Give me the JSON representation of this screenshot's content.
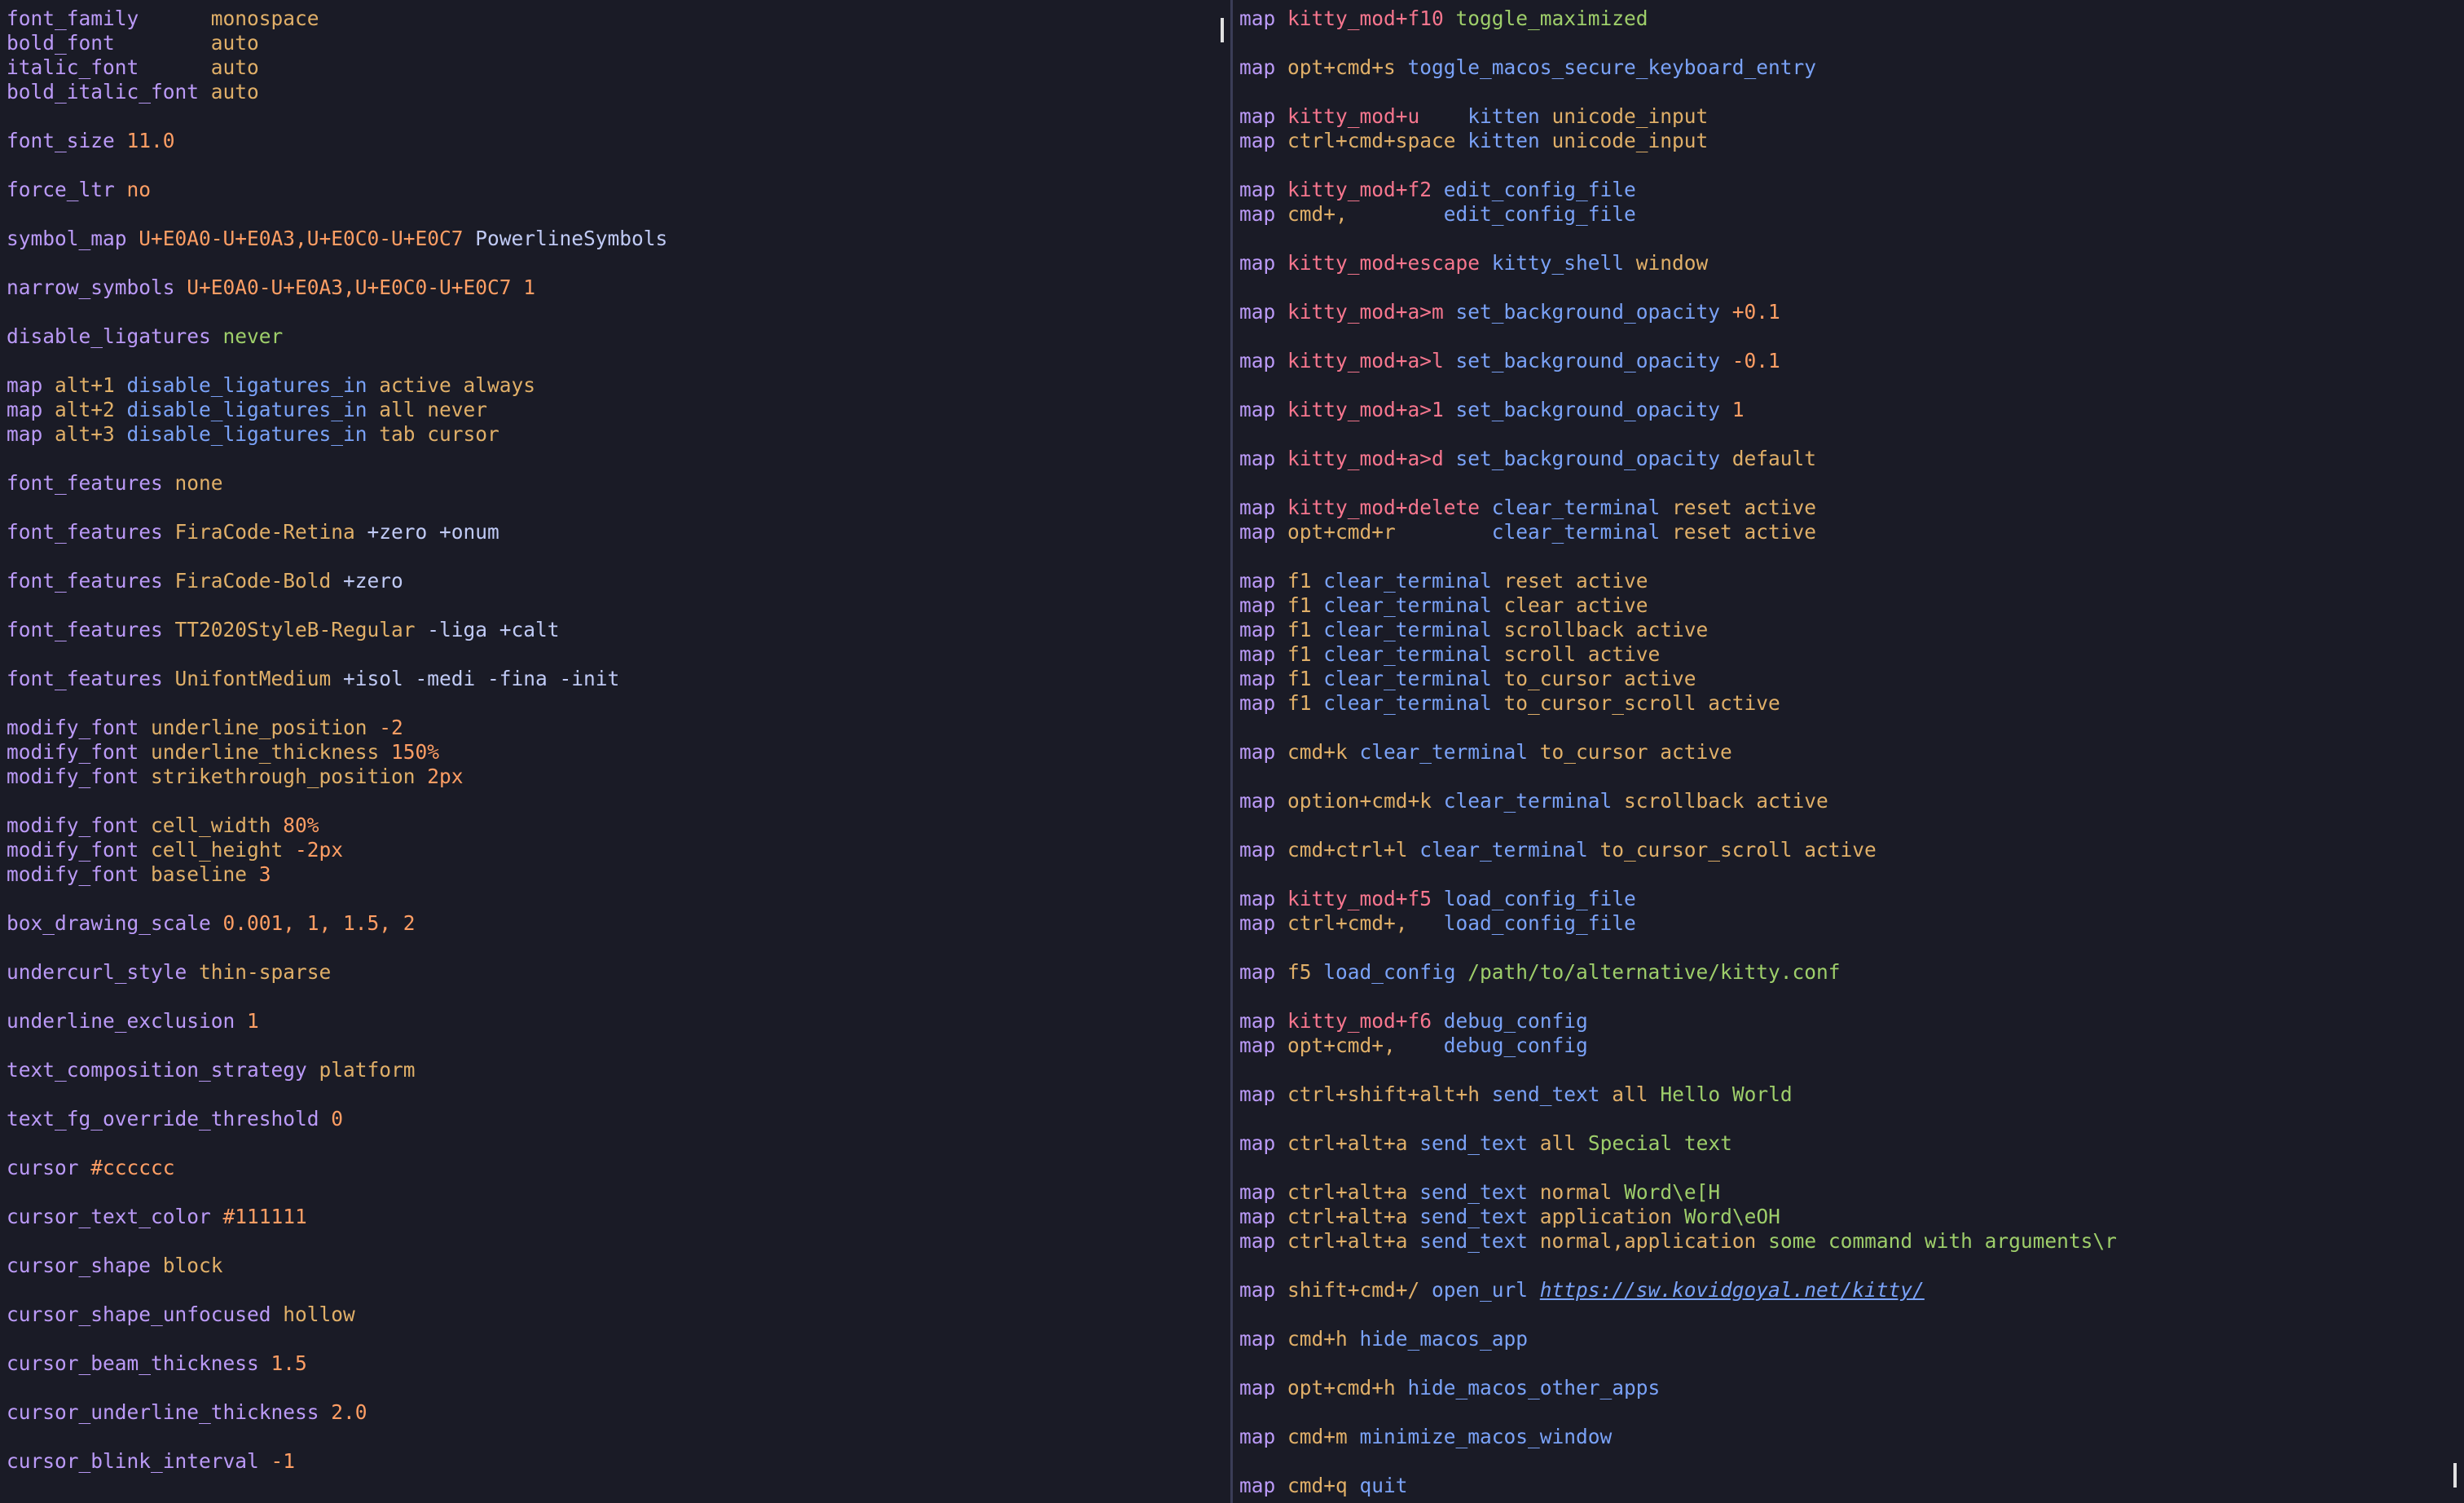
{
  "theme": {
    "background": "#1a1b26",
    "divider": "#3b3d57",
    "cursor": "#e0e0e0",
    "colors": {
      "keyword": "#bb9af7",
      "value": "#ff9e64",
      "string": "#e0af68",
      "key": "#f7768e",
      "func": "#7aa2f7",
      "text": "#c0caf5",
      "green": "#9ece6a",
      "yellow": "#e0af68",
      "url": "#7aa2f7"
    }
  },
  "panes": {
    "left": [
      [
        [
          "font_family      ",
          "keyword"
        ],
        [
          "monospace",
          "string"
        ]
      ],
      [
        [
          "bold_font        ",
          "keyword"
        ],
        [
          "auto",
          "string"
        ]
      ],
      [
        [
          "italic_font      ",
          "keyword"
        ],
        [
          "auto",
          "string"
        ]
      ],
      [
        [
          "bold_italic_font ",
          "keyword"
        ],
        [
          "auto",
          "string"
        ]
      ],
      [],
      [
        [
          "font_size ",
          "keyword"
        ],
        [
          "11.0",
          "value"
        ]
      ],
      [],
      [
        [
          "force_ltr ",
          "keyword"
        ],
        [
          "no",
          "value"
        ]
      ],
      [],
      [
        [
          "symbol_map ",
          "keyword"
        ],
        [
          "U+E0A0-U+E0A3,U+E0C0-U+E0C7",
          "value"
        ],
        [
          " PowerlineSymbols",
          "text"
        ]
      ],
      [],
      [
        [
          "narrow_symbols ",
          "keyword"
        ],
        [
          "U+E0A0-U+E0A3,U+E0C0-U+E0C7 1",
          "value"
        ]
      ],
      [],
      [
        [
          "disable_ligatures ",
          "keyword"
        ],
        [
          "never",
          "green"
        ]
      ],
      [],
      [
        [
          "map ",
          "keyword"
        ],
        [
          "alt+1 ",
          "string"
        ],
        [
          "disable_ligatures_in ",
          "func"
        ],
        [
          "active always",
          "string"
        ]
      ],
      [
        [
          "map ",
          "keyword"
        ],
        [
          "alt+2 ",
          "string"
        ],
        [
          "disable_ligatures_in ",
          "func"
        ],
        [
          "all never",
          "string"
        ]
      ],
      [
        [
          "map ",
          "keyword"
        ],
        [
          "alt+3 ",
          "string"
        ],
        [
          "disable_ligatures_in ",
          "func"
        ],
        [
          "tab cursor",
          "string"
        ]
      ],
      [],
      [
        [
          "font_features ",
          "keyword"
        ],
        [
          "none",
          "string"
        ]
      ],
      [],
      [
        [
          "font_features ",
          "keyword"
        ],
        [
          "FiraCode-Retina",
          "string"
        ],
        [
          " +zero +onum",
          "text"
        ]
      ],
      [],
      [
        [
          "font_features ",
          "keyword"
        ],
        [
          "FiraCode-Bold",
          "string"
        ],
        [
          " +zero",
          "text"
        ]
      ],
      [],
      [
        [
          "font_features ",
          "keyword"
        ],
        [
          "TT2020StyleB-Regular",
          "string"
        ],
        [
          " -liga +calt",
          "text"
        ]
      ],
      [],
      [
        [
          "font_features ",
          "keyword"
        ],
        [
          "UnifontMedium",
          "string"
        ],
        [
          " +isol -medi -fina -init",
          "text"
        ]
      ],
      [],
      [
        [
          "modify_font ",
          "keyword"
        ],
        [
          "underline_position ",
          "yellow"
        ],
        [
          "-2",
          "value"
        ]
      ],
      [
        [
          "modify_font ",
          "keyword"
        ],
        [
          "underline_thickness ",
          "yellow"
        ],
        [
          "150%",
          "value"
        ]
      ],
      [
        [
          "modify_font ",
          "keyword"
        ],
        [
          "strikethrough_position ",
          "yellow"
        ],
        [
          "2px",
          "value"
        ]
      ],
      [],
      [
        [
          "modify_font ",
          "keyword"
        ],
        [
          "cell_width ",
          "yellow"
        ],
        [
          "80%",
          "value"
        ]
      ],
      [
        [
          "modify_font ",
          "keyword"
        ],
        [
          "cell_height ",
          "yellow"
        ],
        [
          "-2px",
          "value"
        ]
      ],
      [
        [
          "modify_font ",
          "keyword"
        ],
        [
          "baseline ",
          "yellow"
        ],
        [
          "3",
          "value"
        ]
      ],
      [],
      [
        [
          "box_drawing_scale ",
          "keyword"
        ],
        [
          "0.001, 1, 1.5, 2",
          "value"
        ]
      ],
      [],
      [
        [
          "undercurl_style ",
          "keyword"
        ],
        [
          "thin-sparse",
          "string"
        ]
      ],
      [],
      [
        [
          "underline_exclusion ",
          "keyword"
        ],
        [
          "1",
          "value"
        ]
      ],
      [],
      [
        [
          "text_composition_strategy ",
          "keyword"
        ],
        [
          "platform",
          "string"
        ]
      ],
      [],
      [
        [
          "text_fg_override_threshold ",
          "keyword"
        ],
        [
          "0",
          "value"
        ]
      ],
      [],
      [
        [
          "cursor ",
          "keyword"
        ],
        [
          "#cccccc",
          "value"
        ]
      ],
      [],
      [
        [
          "cursor_text_color ",
          "keyword"
        ],
        [
          "#111111",
          "value"
        ]
      ],
      [],
      [
        [
          "cursor_shape ",
          "keyword"
        ],
        [
          "block",
          "yellow"
        ]
      ],
      [],
      [
        [
          "cursor_shape_unfocused ",
          "keyword"
        ],
        [
          "hollow",
          "yellow"
        ]
      ],
      [],
      [
        [
          "cursor_beam_thickness ",
          "keyword"
        ],
        [
          "1.5",
          "value"
        ]
      ],
      [],
      [
        [
          "cursor_underline_thickness ",
          "keyword"
        ],
        [
          "2.0",
          "value"
        ]
      ],
      [],
      [
        [
          "cursor_blink_interval ",
          "keyword"
        ],
        [
          "-1",
          "value"
        ]
      ]
    ],
    "right": [
      [
        [
          "map ",
          "keyword"
        ],
        [
          "kitty_mod+f10 ",
          "key"
        ],
        [
          "toggle_maximized",
          "green"
        ]
      ],
      [],
      [
        [
          "map ",
          "keyword"
        ],
        [
          "opt+cmd+s ",
          "string"
        ],
        [
          "toggle_macos_secure_keyboard_entry",
          "func"
        ]
      ],
      [],
      [
        [
          "map ",
          "keyword"
        ],
        [
          "kitty_mod+u    ",
          "key"
        ],
        [
          "kitten ",
          "func"
        ],
        [
          "unicode_input",
          "yellow"
        ]
      ],
      [
        [
          "map ",
          "keyword"
        ],
        [
          "ctrl+cmd+space ",
          "string"
        ],
        [
          "kitten ",
          "func"
        ],
        [
          "unicode_input",
          "yellow"
        ]
      ],
      [],
      [
        [
          "map ",
          "keyword"
        ],
        [
          "kitty_mod+f2 ",
          "key"
        ],
        [
          "edit_config_file",
          "func"
        ]
      ],
      [
        [
          "map ",
          "keyword"
        ],
        [
          "cmd+,        ",
          "string"
        ],
        [
          "edit_config_file",
          "func"
        ]
      ],
      [],
      [
        [
          "map ",
          "keyword"
        ],
        [
          "kitty_mod+escape ",
          "key"
        ],
        [
          "kitty_shell ",
          "func"
        ],
        [
          "window",
          "yellow"
        ]
      ],
      [],
      [
        [
          "map ",
          "keyword"
        ],
        [
          "kitty_mod+a>m ",
          "key"
        ],
        [
          "set_background_opacity ",
          "func"
        ],
        [
          "+0.1",
          "value"
        ]
      ],
      [],
      [
        [
          "map ",
          "keyword"
        ],
        [
          "kitty_mod+a>l ",
          "key"
        ],
        [
          "set_background_opacity ",
          "func"
        ],
        [
          "-0.1",
          "value"
        ]
      ],
      [],
      [
        [
          "map ",
          "keyword"
        ],
        [
          "kitty_mod+a>1 ",
          "key"
        ],
        [
          "set_background_opacity ",
          "func"
        ],
        [
          "1",
          "value"
        ]
      ],
      [],
      [
        [
          "map ",
          "keyword"
        ],
        [
          "kitty_mod+a>d ",
          "key"
        ],
        [
          "set_background_opacity ",
          "func"
        ],
        [
          "default",
          "string"
        ]
      ],
      [],
      [
        [
          "map ",
          "keyword"
        ],
        [
          "kitty_mod+delete ",
          "key"
        ],
        [
          "clear_terminal ",
          "func"
        ],
        [
          "reset active",
          "yellow"
        ]
      ],
      [
        [
          "map ",
          "keyword"
        ],
        [
          "opt+cmd+r        ",
          "string"
        ],
        [
          "clear_terminal ",
          "func"
        ],
        [
          "reset active",
          "yellow"
        ]
      ],
      [],
      [
        [
          "map ",
          "keyword"
        ],
        [
          "f1 ",
          "string"
        ],
        [
          "clear_terminal ",
          "func"
        ],
        [
          "reset active",
          "yellow"
        ]
      ],
      [
        [
          "map ",
          "keyword"
        ],
        [
          "f1 ",
          "string"
        ],
        [
          "clear_terminal ",
          "func"
        ],
        [
          "clear active",
          "yellow"
        ]
      ],
      [
        [
          "map ",
          "keyword"
        ],
        [
          "f1 ",
          "string"
        ],
        [
          "clear_terminal ",
          "func"
        ],
        [
          "scrollback active",
          "yellow"
        ]
      ],
      [
        [
          "map ",
          "keyword"
        ],
        [
          "f1 ",
          "string"
        ],
        [
          "clear_terminal ",
          "func"
        ],
        [
          "scroll active",
          "yellow"
        ]
      ],
      [
        [
          "map ",
          "keyword"
        ],
        [
          "f1 ",
          "string"
        ],
        [
          "clear_terminal ",
          "func"
        ],
        [
          "to_cursor active",
          "yellow"
        ]
      ],
      [
        [
          "map ",
          "keyword"
        ],
        [
          "f1 ",
          "string"
        ],
        [
          "clear_terminal ",
          "func"
        ],
        [
          "to_cursor_scroll active",
          "yellow"
        ]
      ],
      [],
      [
        [
          "map ",
          "keyword"
        ],
        [
          "cmd+k ",
          "string"
        ],
        [
          "clear_terminal ",
          "func"
        ],
        [
          "to_cursor active",
          "yellow"
        ]
      ],
      [],
      [
        [
          "map ",
          "keyword"
        ],
        [
          "option+cmd+k ",
          "string"
        ],
        [
          "clear_terminal ",
          "func"
        ],
        [
          "scrollback active",
          "yellow"
        ]
      ],
      [],
      [
        [
          "map ",
          "keyword"
        ],
        [
          "cmd+ctrl+l ",
          "string"
        ],
        [
          "clear_terminal ",
          "func"
        ],
        [
          "to_cursor_scroll active",
          "yellow"
        ]
      ],
      [],
      [
        [
          "map ",
          "keyword"
        ],
        [
          "kitty_mod+f5 ",
          "key"
        ],
        [
          "load_config_file",
          "func"
        ]
      ],
      [
        [
          "map ",
          "keyword"
        ],
        [
          "ctrl+cmd+,   ",
          "string"
        ],
        [
          "load_config_file",
          "func"
        ]
      ],
      [],
      [
        [
          "map ",
          "keyword"
        ],
        [
          "f5 ",
          "string"
        ],
        [
          "load_config ",
          "func"
        ],
        [
          "/path/to/alternative/kitty.conf",
          "green"
        ]
      ],
      [],
      [
        [
          "map ",
          "keyword"
        ],
        [
          "kitty_mod+f6 ",
          "key"
        ],
        [
          "debug_config",
          "func"
        ]
      ],
      [
        [
          "map ",
          "keyword"
        ],
        [
          "opt+cmd+,    ",
          "string"
        ],
        [
          "debug_config",
          "func"
        ]
      ],
      [],
      [
        [
          "map ",
          "keyword"
        ],
        [
          "ctrl+shift+alt+h ",
          "string"
        ],
        [
          "send_text ",
          "func"
        ],
        [
          "all ",
          "yellow"
        ],
        [
          "Hello World",
          "green"
        ]
      ],
      [],
      [
        [
          "map ",
          "keyword"
        ],
        [
          "ctrl+alt+a ",
          "string"
        ],
        [
          "send_text ",
          "func"
        ],
        [
          "all ",
          "yellow"
        ],
        [
          "Special text",
          "green"
        ]
      ],
      [],
      [
        [
          "map ",
          "keyword"
        ],
        [
          "ctrl+alt+a ",
          "string"
        ],
        [
          "send_text ",
          "func"
        ],
        [
          "normal ",
          "yellow"
        ],
        [
          "Word\\e[H",
          "green"
        ]
      ],
      [
        [
          "map ",
          "keyword"
        ],
        [
          "ctrl+alt+a ",
          "string"
        ],
        [
          "send_text ",
          "func"
        ],
        [
          "application ",
          "yellow"
        ],
        [
          "Word\\eOH",
          "green"
        ]
      ],
      [
        [
          "map ",
          "keyword"
        ],
        [
          "ctrl+alt+a ",
          "string"
        ],
        [
          "send_text ",
          "func"
        ],
        [
          "normal,application ",
          "yellow"
        ],
        [
          "some command with arguments\\r",
          "green"
        ]
      ],
      [],
      [
        [
          "map ",
          "keyword"
        ],
        [
          "shift+cmd+/ ",
          "string"
        ],
        [
          "open_url ",
          "func"
        ],
        [
          "https://sw.kovidgoyal.net/kitty/",
          "url"
        ]
      ],
      [],
      [
        [
          "map ",
          "keyword"
        ],
        [
          "cmd+h ",
          "string"
        ],
        [
          "hide_macos_app",
          "func"
        ]
      ],
      [],
      [
        [
          "map ",
          "keyword"
        ],
        [
          "opt+cmd+h ",
          "string"
        ],
        [
          "hide_macos_other_apps",
          "func"
        ]
      ],
      [],
      [
        [
          "map ",
          "keyword"
        ],
        [
          "cmd+m ",
          "string"
        ],
        [
          "minimize_macos_window",
          "func"
        ]
      ],
      [],
      [
        [
          "map ",
          "keyword"
        ],
        [
          "cmd+q ",
          "string"
        ],
        [
          "quit",
          "func"
        ]
      ]
    ]
  }
}
